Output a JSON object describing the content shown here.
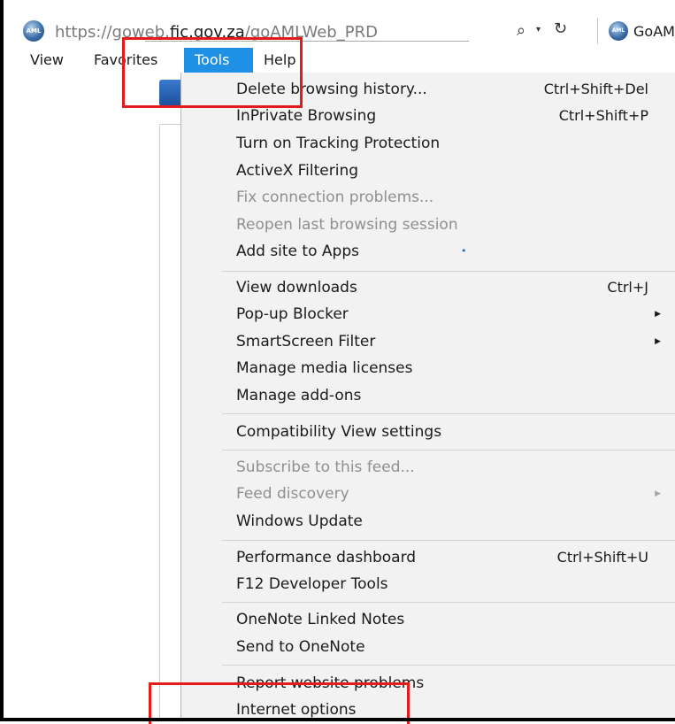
{
  "browser": {
    "url_prefix": "https://goweb.",
    "url_domain": "fic.gov.za",
    "url_path": "/goAMLWeb_PRD",
    "site_icon_label": "AML",
    "tab_title": "GoAM",
    "search_icon": "search-icon",
    "refresh_icon": "refresh-icon"
  },
  "menubar": {
    "view": "View",
    "favorites": "Favorites",
    "tools": "Tools",
    "help": "Help"
  },
  "tools_menu": {
    "delete_history": {
      "label": "Delete browsing history...",
      "shortcut": "Ctrl+Shift+Del"
    },
    "inprivate": {
      "label": "InPrivate Browsing",
      "shortcut": "Ctrl+Shift+P"
    },
    "tracking": {
      "label": "Turn on Tracking Protection"
    },
    "activex": {
      "label": "ActiveX Filtering"
    },
    "fix_connection": {
      "label": "Fix connection problems..."
    },
    "reopen_session": {
      "label": "Reopen last browsing session"
    },
    "add_site": {
      "label": "Add site to Apps"
    },
    "view_downloads": {
      "label": "View downloads",
      "shortcut": "Ctrl+J"
    },
    "popup_blocker": {
      "label": "Pop-up Blocker"
    },
    "smartscreen": {
      "label": "SmartScreen Filter"
    },
    "media_licenses": {
      "label": "Manage media licenses"
    },
    "addons": {
      "label": "Manage add-ons"
    },
    "compat_view": {
      "label": "Compatibility View settings"
    },
    "subscribe_feed": {
      "label": "Subscribe to this feed..."
    },
    "feed_discovery": {
      "label": "Feed discovery"
    },
    "windows_update": {
      "label": "Windows Update"
    },
    "perf_dashboard": {
      "label": "Performance dashboard",
      "shortcut": "Ctrl+Shift+U"
    },
    "f12": {
      "label": "F12 Developer Tools"
    },
    "onenote_linked": {
      "label": "OneNote Linked Notes"
    },
    "send_onenote": {
      "label": "Send to OneNote"
    },
    "report_problems": {
      "label": "Report website problems"
    },
    "internet_options": {
      "label": "Internet options"
    }
  },
  "highlight_color": "#e41b1b",
  "accent_color": "#1e90e6"
}
